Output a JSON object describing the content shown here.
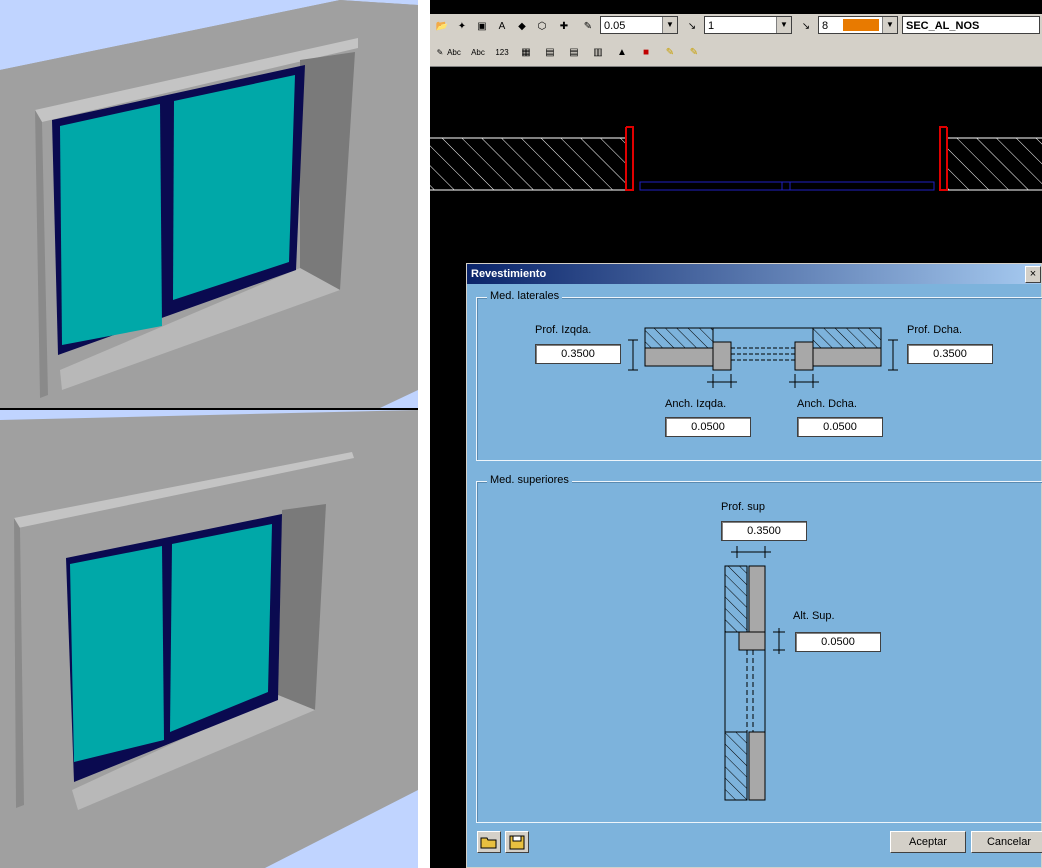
{
  "toolbar": {
    "value_1": "0.05",
    "value_2": "1",
    "value_3": "8",
    "layer": "SEC_AL_NOS",
    "accent": "#e87a00",
    "text_tool_1": "Abc",
    "text_tool_2": "Abc",
    "text_tool_3": "123"
  },
  "dialog": {
    "title": "Revestimiento",
    "close_glyph": "×",
    "lateral": {
      "group_label": "Med. laterales",
      "prof_izq_label": "Prof. Izqda.",
      "prof_izq_value": "0.3500",
      "prof_der_label": "Prof. Dcha.",
      "prof_der_value": "0.3500",
      "anch_izq_label": "Anch. Izqda.",
      "anch_izq_value": "0.0500",
      "anch_der_label": "Anch. Dcha.",
      "anch_der_value": "0.0500"
    },
    "superior": {
      "group_label": "Med. superiores",
      "prof_sup_label": "Prof. sup",
      "prof_sup_value": "0.3500",
      "alt_sup_label": "Alt. Sup.",
      "alt_sup_value": "0.0500"
    },
    "accept_label": "Aceptar",
    "cancel_label": "Cancelar",
    "colors": {
      "background": "#7db3dc",
      "title_start": "#0a246a",
      "title_end": "#a6caf0"
    }
  },
  "renders": {
    "glass_color": "#00a8a8",
    "frame_color": "#0a0a50",
    "wall_color": "#a0a0a0",
    "sky_color": "#c0d4ff"
  }
}
